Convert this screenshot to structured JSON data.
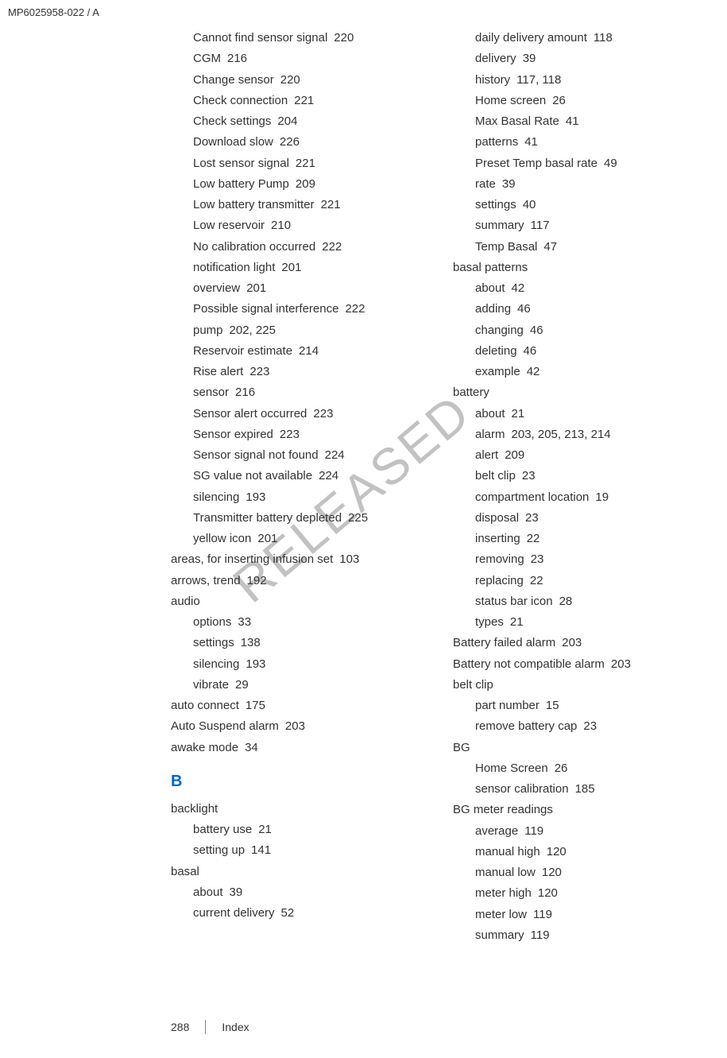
{
  "header": "MP6025958-022 / A",
  "watermark": "RELEASED",
  "footer": {
    "page": "288",
    "section": "Index"
  },
  "columns": [
    {
      "items": [
        {
          "level": 1,
          "term": "Cannot find sensor signal",
          "pages": "220"
        },
        {
          "level": 1,
          "term": "CGM",
          "pages": "216"
        },
        {
          "level": 1,
          "term": "Change sensor",
          "pages": "220"
        },
        {
          "level": 1,
          "term": "Check connection",
          "pages": "221"
        },
        {
          "level": 1,
          "term": "Check settings",
          "pages": "204"
        },
        {
          "level": 1,
          "term": "Download slow",
          "pages": "226"
        },
        {
          "level": 1,
          "term": "Lost sensor signal",
          "pages": "221"
        },
        {
          "level": 1,
          "term": "Low battery Pump",
          "pages": "209"
        },
        {
          "level": 1,
          "term": "Low battery transmitter",
          "pages": "221"
        },
        {
          "level": 1,
          "term": "Low reservoir",
          "pages": "210"
        },
        {
          "level": 1,
          "term": "No calibration occurred",
          "pages": "222"
        },
        {
          "level": 1,
          "term": "notification light",
          "pages": "201"
        },
        {
          "level": 1,
          "term": "overview",
          "pages": "201"
        },
        {
          "level": 1,
          "term": "Possible signal interference",
          "pages": "222"
        },
        {
          "level": 1,
          "term": "pump",
          "pages": "202, 225"
        },
        {
          "level": 1,
          "term": "Reservoir estimate",
          "pages": "214"
        },
        {
          "level": 1,
          "term": "Rise alert",
          "pages": "223"
        },
        {
          "level": 1,
          "term": "sensor",
          "pages": "216"
        },
        {
          "level": 1,
          "term": "Sensor alert occurred",
          "pages": "223"
        },
        {
          "level": 1,
          "term": "Sensor expired",
          "pages": "223"
        },
        {
          "level": 1,
          "term": "Sensor signal not found",
          "pages": "224"
        },
        {
          "level": 1,
          "term": "SG value not available",
          "pages": "224"
        },
        {
          "level": 1,
          "term": "silencing",
          "pages": "193"
        },
        {
          "level": 1,
          "term": "Transmitter battery depleted",
          "pages": "225"
        },
        {
          "level": 1,
          "term": "yellow icon",
          "pages": "201"
        },
        {
          "level": 0,
          "term": "areas, for inserting infusion set",
          "pages": "103"
        },
        {
          "level": 0,
          "term": "arrows, trend",
          "pages": "192"
        },
        {
          "level": 0,
          "term": "audio",
          "pages": ""
        },
        {
          "level": 1,
          "term": "options",
          "pages": "33"
        },
        {
          "level": 1,
          "term": "settings",
          "pages": "138"
        },
        {
          "level": 1,
          "term": "silencing",
          "pages": "193"
        },
        {
          "level": 1,
          "term": "vibrate",
          "pages": "29"
        },
        {
          "level": 0,
          "term": "auto connect",
          "pages": "175"
        },
        {
          "level": 0,
          "term": "Auto Suspend alarm",
          "pages": "203"
        },
        {
          "level": 0,
          "term": "awake mode",
          "pages": "34"
        },
        {
          "section": "B"
        },
        {
          "level": 0,
          "term": "backlight",
          "pages": ""
        },
        {
          "level": 1,
          "term": "battery use",
          "pages": "21"
        },
        {
          "level": 1,
          "term": "setting up",
          "pages": "141"
        },
        {
          "level": 0,
          "term": "basal",
          "pages": ""
        },
        {
          "level": 1,
          "term": "about",
          "pages": "39"
        },
        {
          "level": 1,
          "term": "current delivery",
          "pages": "52"
        }
      ]
    },
    {
      "items": [
        {
          "level": 1,
          "term": "daily delivery amount",
          "pages": "118"
        },
        {
          "level": 1,
          "term": "delivery",
          "pages": "39"
        },
        {
          "level": 1,
          "term": "history",
          "pages": "117, 118"
        },
        {
          "level": 1,
          "term": "Home screen",
          "pages": "26"
        },
        {
          "level": 1,
          "term": "Max Basal Rate",
          "pages": "41"
        },
        {
          "level": 1,
          "term": "patterns",
          "pages": "41"
        },
        {
          "level": 1,
          "term": "Preset Temp basal rate",
          "pages": "49"
        },
        {
          "level": 1,
          "term": "rate",
          "pages": "39"
        },
        {
          "level": 1,
          "term": "settings",
          "pages": "40"
        },
        {
          "level": 1,
          "term": "summary",
          "pages": "117"
        },
        {
          "level": 1,
          "term": "Temp Basal",
          "pages": "47"
        },
        {
          "level": 0,
          "term": "basal patterns",
          "pages": ""
        },
        {
          "level": 1,
          "term": "about",
          "pages": "42"
        },
        {
          "level": 1,
          "term": "adding",
          "pages": "46"
        },
        {
          "level": 1,
          "term": "changing",
          "pages": "46"
        },
        {
          "level": 1,
          "term": "deleting",
          "pages": "46"
        },
        {
          "level": 1,
          "term": "example",
          "pages": "42"
        },
        {
          "level": 0,
          "term": "battery",
          "pages": ""
        },
        {
          "level": 1,
          "term": "about",
          "pages": "21"
        },
        {
          "level": 1,
          "term": "alarm",
          "pages": "203, 205, 213, 214"
        },
        {
          "level": 1,
          "term": "alert",
          "pages": "209"
        },
        {
          "level": 1,
          "term": "belt clip",
          "pages": "23"
        },
        {
          "level": 1,
          "term": "compartment location",
          "pages": "19"
        },
        {
          "level": 1,
          "term": "disposal",
          "pages": "23"
        },
        {
          "level": 1,
          "term": "inserting",
          "pages": "22"
        },
        {
          "level": 1,
          "term": "removing",
          "pages": "23"
        },
        {
          "level": 1,
          "term": "replacing",
          "pages": "22"
        },
        {
          "level": 1,
          "term": "status bar icon",
          "pages": "28"
        },
        {
          "level": 1,
          "term": "types",
          "pages": "21"
        },
        {
          "level": 0,
          "term": "Battery failed alarm",
          "pages": "203"
        },
        {
          "level": 0,
          "term": "Battery not compatible alarm",
          "pages": "203"
        },
        {
          "level": 0,
          "term": "belt clip",
          "pages": ""
        },
        {
          "level": 1,
          "term": "part number",
          "pages": "15"
        },
        {
          "level": 1,
          "term": "remove battery cap",
          "pages": "23"
        },
        {
          "level": 0,
          "term": "BG",
          "pages": ""
        },
        {
          "level": 1,
          "term": "Home Screen",
          "pages": "26"
        },
        {
          "level": 1,
          "term": "sensor calibration",
          "pages": "185"
        },
        {
          "level": 0,
          "term": "BG meter readings",
          "pages": ""
        },
        {
          "level": 1,
          "term": "average",
          "pages": "119"
        },
        {
          "level": 1,
          "term": "manual high",
          "pages": "120"
        },
        {
          "level": 1,
          "term": "manual low",
          "pages": "120"
        },
        {
          "level": 1,
          "term": "meter high",
          "pages": "120"
        },
        {
          "level": 1,
          "term": "meter low",
          "pages": "119"
        },
        {
          "level": 1,
          "term": "summary",
          "pages": "119"
        }
      ]
    }
  ]
}
